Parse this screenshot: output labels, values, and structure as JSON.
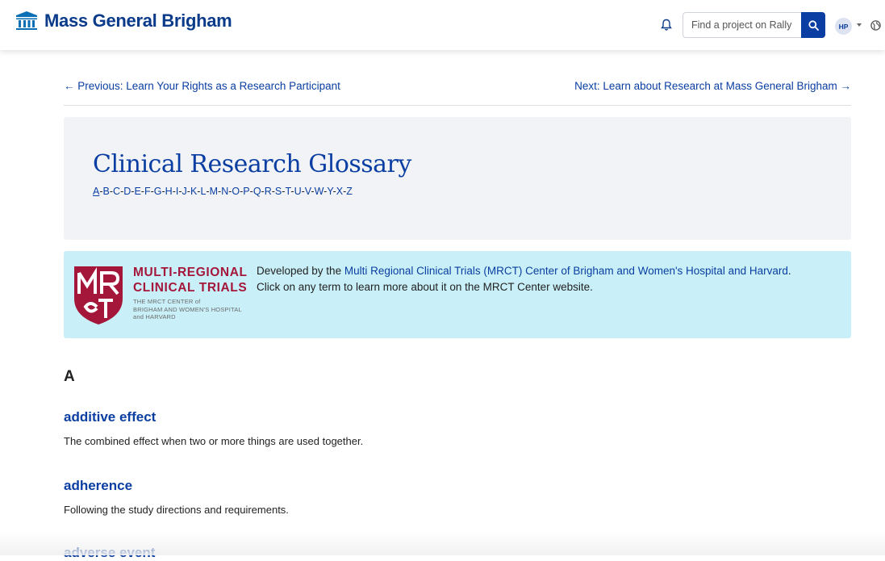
{
  "header": {
    "brand_name": "Mass General Brigham",
    "brand_icon": "columns-building-icon",
    "search_placeholder": "Find a project on Rally",
    "avatar_initials": "HP",
    "brand_color": "#0a3a8a",
    "accent_color": "#0a3ea2"
  },
  "nav": {
    "previous": "← Previous: Learn Your Rights as a Research Participant",
    "next": "Next: Learn about Research at Mass General Brigham →"
  },
  "glossary": {
    "title": "Clinical Research Glossary",
    "letters": [
      "A",
      "B",
      "C",
      "D",
      "E",
      "F",
      "G",
      "H",
      "I",
      "J",
      "K",
      "L",
      "M",
      "N",
      "O",
      "P",
      "Q",
      "R",
      "S",
      "T",
      "U",
      "V",
      "W",
      "Y",
      "X",
      "Z"
    ],
    "active_letter": "A"
  },
  "mrct": {
    "logo_line1": "MULTI-REGIONAL",
    "logo_line2": "CLINICAL TRIALS",
    "logo_small1": "THE MRCT CENTER of",
    "logo_small2": "BRIGHAM AND WOMEN'S HOSPITAL",
    "logo_small3": "and HARVARD",
    "text_prefix": "Developed by the ",
    "text_link": "Multi Regional Clinical Trials (MRCT) Center of Brigham and Women's Hospital and Harvard",
    "text_suffix": ".",
    "text_line2": "Click on any term to learn more about it on the MRCT Center website.",
    "banner_color": "#c9f0f8",
    "logo_color": "#a5173a"
  },
  "entries": {
    "letter": "A",
    "items": [
      {
        "term": "additive effect",
        "definition": "The combined effect when two or more things are used together."
      },
      {
        "term": "adherence",
        "definition": "Following the study directions and requirements."
      },
      {
        "term": "adverse event",
        "definition": ""
      }
    ]
  }
}
